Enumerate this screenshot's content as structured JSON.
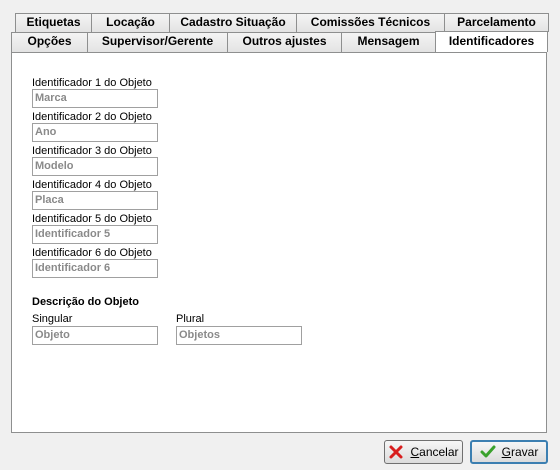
{
  "tabs_back": [
    "Etiquetas",
    "Locação",
    "Cadastro Situação",
    "Comissões Técnicos",
    "Parcelamento"
  ],
  "tabs_front": [
    "Opções",
    "Supervisor/Gerente",
    "Outros ajustes",
    "Mensagem",
    "Identificadores"
  ],
  "active_tab": "Identificadores",
  "identifiers": [
    {
      "label": "Identificador 1 do Objeto",
      "placeholder": "Marca"
    },
    {
      "label": "Identificador 2 do Objeto",
      "placeholder": "Ano"
    },
    {
      "label": "Identificador 3 do Objeto",
      "placeholder": "Modelo"
    },
    {
      "label": "Identificador 4 do Objeto",
      "placeholder": "Placa"
    },
    {
      "label": "Identificador 5 do Objeto",
      "placeholder": "Identificador 5"
    },
    {
      "label": "Identificador 6 do Objeto",
      "placeholder": "Identificador 6"
    }
  ],
  "description": {
    "title": "Descrição do Objeto",
    "singular_label": "Singular",
    "singular_placeholder": "Objeto",
    "plural_label": "Plural",
    "plural_placeholder": "Objetos"
  },
  "buttons": {
    "cancel_first": "C",
    "cancel_rest": "ancelar",
    "save_first": "G",
    "save_rest": "ravar"
  },
  "colors": {
    "cancel_icon": "#d81e1e",
    "save_icon": "#3aa12c",
    "default_border": "#3c7fb1"
  }
}
